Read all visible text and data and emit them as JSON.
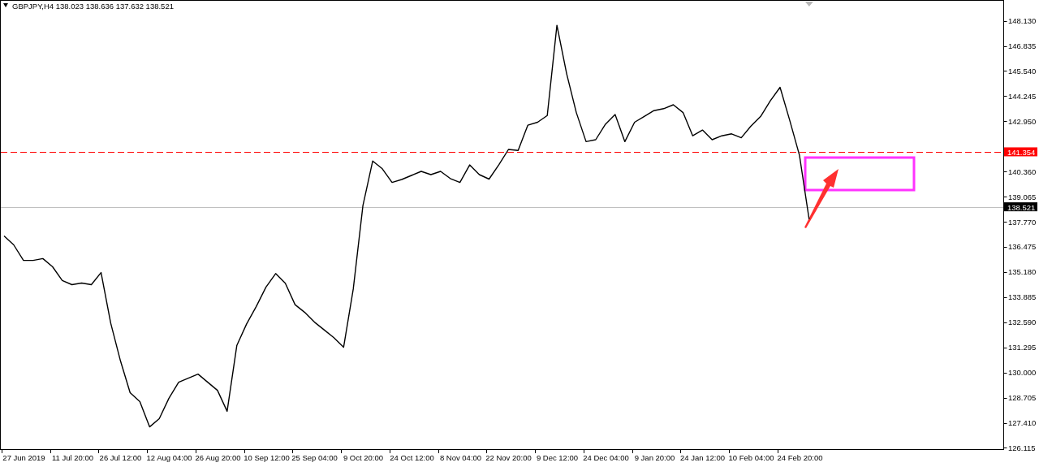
{
  "chart": {
    "chart_data": {
      "type": "line",
      "title": "GBPJPY,H4 138.023 138.636 137.632 138.521",
      "categories": [
        null,
        null,
        "27 Jun 2019",
        null,
        null,
        null,
        null,
        "11 Jul 20:00",
        null,
        null,
        null,
        null,
        "26 Jul 12:00",
        null,
        null,
        null,
        null,
        "12 Aug 04:00",
        null,
        null,
        null,
        null,
        "26 Aug 20:00",
        null,
        null,
        null,
        null,
        "10 Sep 12:00",
        null,
        null,
        null,
        null,
        "25 Sep 04:00",
        null,
        null,
        null,
        null,
        "9 Oct 20:00",
        null,
        null,
        null,
        null,
        "24 Oct 12:00",
        null,
        null,
        null,
        null,
        "8 Nov 04:00",
        null,
        null,
        null,
        null,
        "22 Nov 20:00",
        null,
        null,
        null,
        null,
        "9 Dec 12:00",
        null,
        null,
        null,
        null,
        "24 Dec 04:00",
        null,
        null,
        null,
        null,
        "9 Jan 20:00",
        null,
        null,
        null,
        null,
        "24 Jan 12:00",
        null,
        null,
        null,
        null,
        "10 Feb 04:00",
        null,
        null,
        null,
        null,
        "24 Feb 20:00",
        null
      ],
      "series": [
        {
          "color": "#000000",
          "values": [
            137.04,
            136.58,
            135.78,
            135.78,
            135.87,
            135.45,
            134.74,
            134.53,
            134.61,
            134.53,
            135.15,
            132.55,
            130.6,
            128.96,
            128.5,
            127.2,
            127.62,
            128.67,
            129.5,
            129.71,
            129.92,
            129.5,
            129.08,
            128.0,
            131.4,
            132.5,
            133.4,
            134.4,
            135.1,
            134.6,
            133.5,
            133.1,
            132.6,
            132.2,
            131.8,
            131.3,
            134.3,
            138.6,
            140.9,
            140.5,
            139.8,
            139.95,
            140.16,
            140.37,
            140.2,
            140.37,
            140.0,
            139.8,
            140.7,
            140.2,
            139.97,
            140.7,
            141.5,
            141.45,
            142.75,
            142.9,
            143.25,
            147.9,
            145.4,
            143.4,
            141.9,
            142.0,
            142.8,
            143.3,
            141.9,
            142.9,
            143.2,
            143.5,
            143.6,
            143.8,
            143.4,
            142.2,
            142.5,
            142.0,
            142.2,
            142.3,
            142.1,
            142.7,
            143.2,
            144.0,
            144.7,
            143.0,
            141.2,
            137.9
          ]
        }
      ],
      "ylim": [
        126.03,
        149.18
      ],
      "yticks": [
        {
          "value": 126.115,
          "label": "126.115"
        },
        {
          "value": 127.41,
          "label": "127.410"
        },
        {
          "value": 128.705,
          "label": "128.705"
        },
        {
          "value": 130,
          "label": "130.000"
        },
        {
          "value": 131.295,
          "label": "131.295"
        },
        {
          "value": 132.59,
          "label": "132.590"
        },
        {
          "value": 133.885,
          "label": "133.885"
        },
        {
          "value": 135.18,
          "label": "135.180"
        },
        {
          "value": 136.475,
          "label": "136.475"
        },
        {
          "value": 137.77,
          "label": "137.770"
        },
        {
          "value": 139.065,
          "label": "139.065"
        },
        {
          "value": 140.36,
          "label": "140.360"
        },
        {
          "value": 142.95,
          "label": "142.950"
        },
        {
          "value": 144.245,
          "label": "144.245"
        },
        {
          "value": 145.54,
          "label": "145.540"
        },
        {
          "value": 146.835,
          "label": "146.835"
        },
        {
          "value": 148.13,
          "label": "148.130"
        }
      ],
      "ref_lines": [
        {
          "axis": "y",
          "value": 141.354,
          "label": "141.354",
          "color": "#ff0000"
        },
        {
          "axis": "y",
          "value": 138.521,
          "label": "138.521",
          "color": "#c0c0c0"
        }
      ]
    }
  }
}
